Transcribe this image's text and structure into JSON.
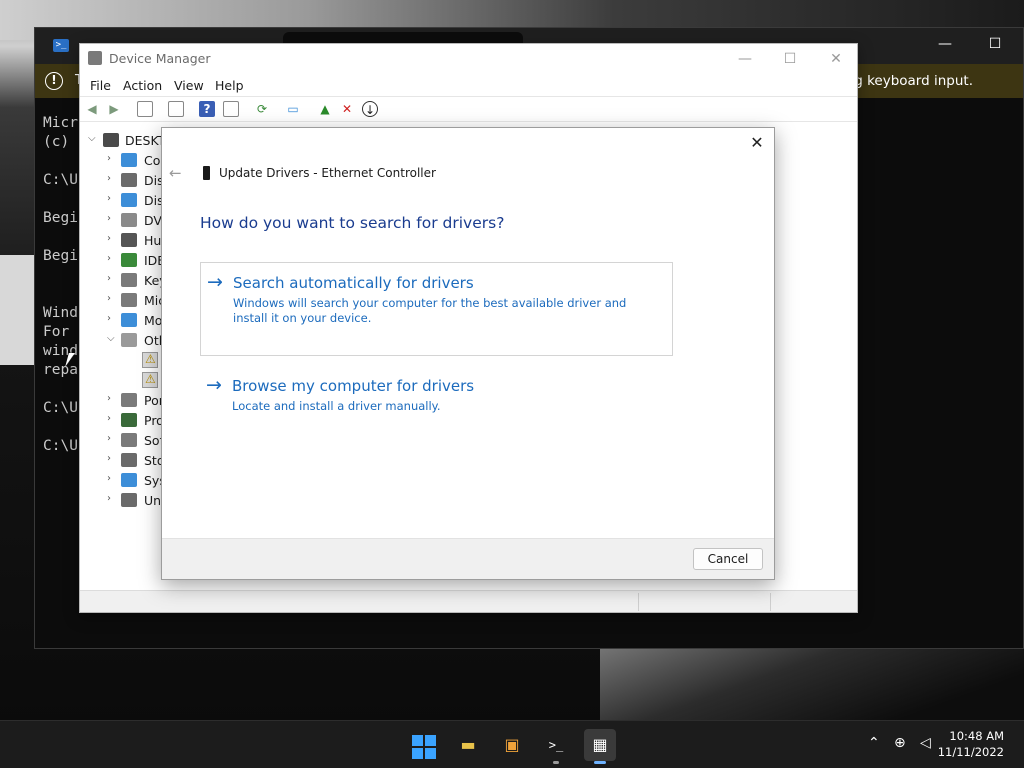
{
  "console": {
    "warning_prefix": "T",
    "warning_text": "ng keyboard input.",
    "lines": [
      "Micr",
      "(c)",
      "",
      "C:\\U",
      "",
      "Begi",
      "",
      "Begi",
      "",
      "",
      "Wind",
      "For",
      "wind",
      "repa",
      "",
      "C:\\U",
      "",
      "C:\\U"
    ]
  },
  "device_manager": {
    "title": "Device Manager",
    "menu": [
      "File",
      "Action",
      "View",
      "Help"
    ],
    "root": "DESKTO",
    "tree": [
      {
        "label": "Cor",
        "color": "#3d8ed8"
      },
      {
        "label": "Dis",
        "color": "#6b6b6b"
      },
      {
        "label": "Dis",
        "color": "#3d8ed8"
      },
      {
        "label": "DVI",
        "color": "#8a8a8a"
      },
      {
        "label": "Hur",
        "color": "#555555"
      },
      {
        "label": "IDE",
        "color": "#3a8a3a"
      },
      {
        "label": "Key",
        "color": "#7a7a7a"
      },
      {
        "label": "Mic",
        "color": "#7a7a7a"
      },
      {
        "label": "Mo",
        "color": "#3d8ed8"
      },
      {
        "label": "Oth",
        "color": "#9a9a9a"
      },
      {
        "label": "Por",
        "color": "#7a7a7a"
      },
      {
        "label": "Pro",
        "color": "#3a6a3a"
      },
      {
        "label": "Sof",
        "color": "#7a7a7a"
      },
      {
        "label": "Sto",
        "color": "#6a6a6a"
      },
      {
        "label": "Sys",
        "color": "#3d8ed8"
      },
      {
        "label": "Uni",
        "color": "#6a6a6a"
      }
    ]
  },
  "dialog": {
    "title": "Update Drivers - Ethernet Controller",
    "heading": "How do you want to search for drivers?",
    "option1_title": "Search automatically for drivers",
    "option1_desc": "Windows will search your computer for the best available driver and install it on your device.",
    "option2_title": "Browse my computer for drivers",
    "option2_desc": "Locate and install a driver manually.",
    "cancel_label": "Cancel"
  },
  "taskbar": {
    "time": "10:48 AM",
    "date": "11/11/2022"
  },
  "colors": {
    "link_blue": "#1c6bbd",
    "heading_blue": "#1a3c8f",
    "start_blue": "#3aa3ff"
  }
}
